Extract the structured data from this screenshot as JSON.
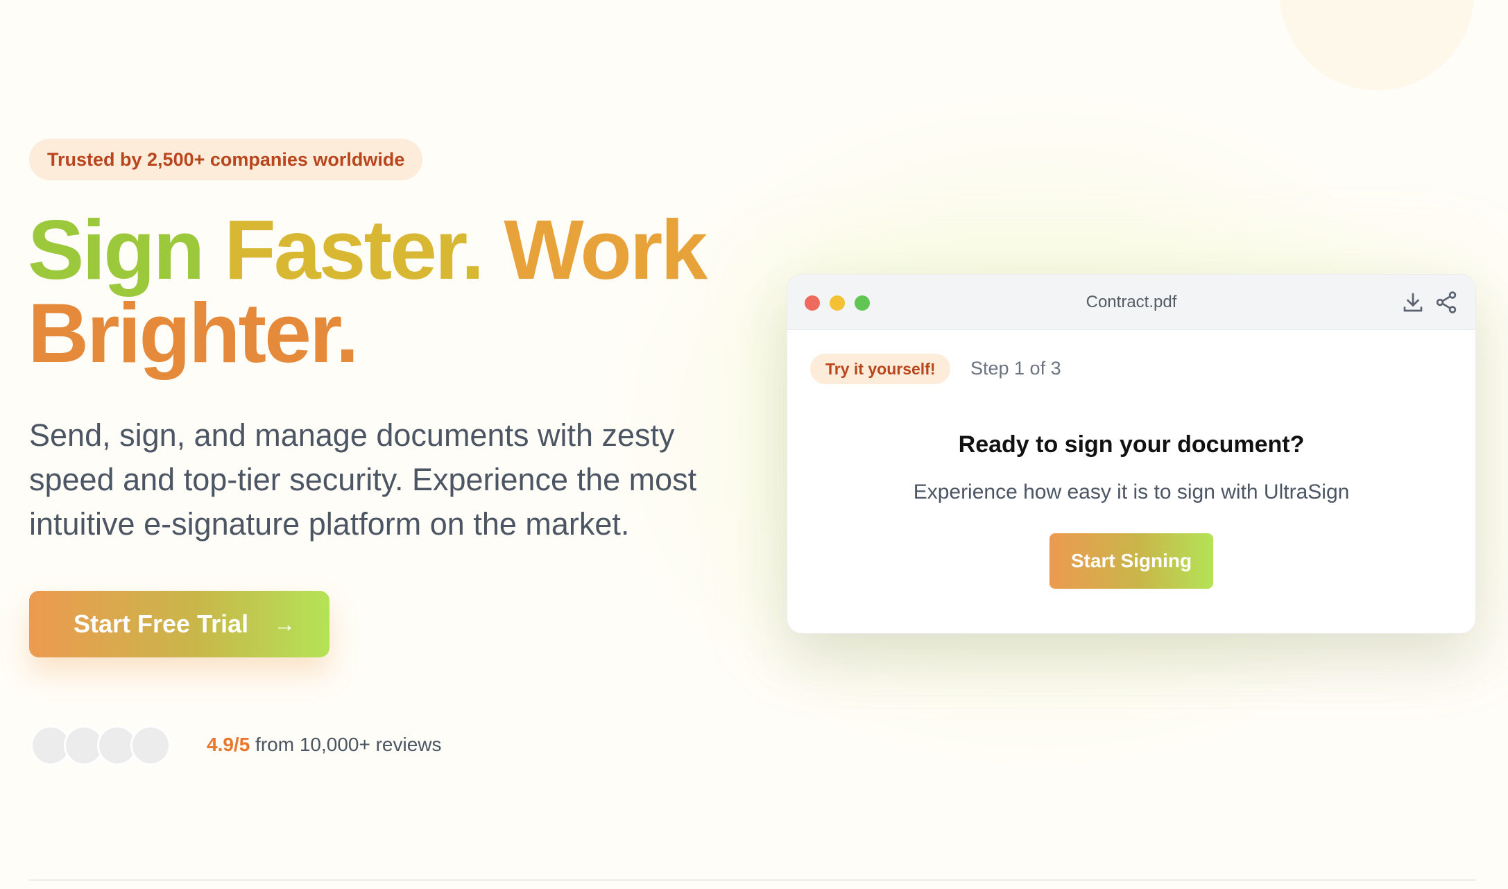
{
  "hero": {
    "badge": "Trusted by 2,500+ companies worldwide",
    "headline": {
      "part1": "Sign ",
      "part2": "Faster. ",
      "part3": "Work",
      "part4": "Brighter."
    },
    "subtitle": "Send, sign, and manage documents with zesty speed and top-tier security. Experience the most intuitive e-signature platform on the market.",
    "cta_label": "Start Free Trial",
    "cta_icon": "arrow-right-icon",
    "rating_score": "4.9/5",
    "rating_text": " from 10,000+ reviews",
    "avatar_count": 4
  },
  "demo_window": {
    "title": "Contract.pdf",
    "icons": [
      "download-icon",
      "share-icon"
    ],
    "pill": "Try it yourself!",
    "step": "Step 1 of 3",
    "heading": "Ready to sign your document?",
    "description": "Experience how easy it is to sign with UltraSign",
    "button_label": "Start Signing"
  },
  "colors": {
    "accent_orange": "#e8782f",
    "accent_green": "#b4e356",
    "badge_bg": "#fdecd9",
    "badge_text": "#b8451b",
    "window_dot_red": "#ed6a5e",
    "window_dot_yellow": "#f4c134",
    "window_dot_green": "#61c554"
  }
}
